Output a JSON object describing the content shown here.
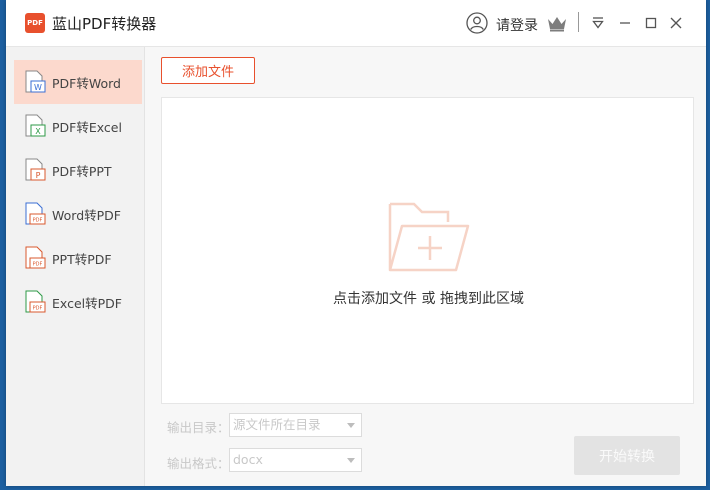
{
  "app": {
    "logo_text": "PDF",
    "title": "蓝山PDF转换器",
    "brand_color": "#e8502d"
  },
  "header": {
    "login_label": "请登录",
    "icons": [
      "user-icon",
      "crown-icon",
      "menu-icon",
      "minimize-icon",
      "maximize-icon",
      "close-icon"
    ]
  },
  "sidebar": {
    "active_index": 0,
    "items": [
      {
        "label": "PDF转Word",
        "badge": "W",
        "badge_color": "#3b6fd4"
      },
      {
        "label": "PDF转Excel",
        "badge": "X",
        "badge_color": "#2e9a47"
      },
      {
        "label": "PDF转PPT",
        "badge": "P",
        "badge_color": "#d9582e"
      },
      {
        "label": "Word转PDF",
        "badge": "PDF",
        "badge_color": "#d9582e"
      },
      {
        "label": "PPT转PDF",
        "badge": "PDF",
        "badge_color": "#d9582e"
      },
      {
        "label": "Excel转PDF",
        "badge": "PDF",
        "badge_color": "#d9582e"
      }
    ]
  },
  "main": {
    "add_file_label": "添加文件",
    "drop_hint": "点击添加文件 或 拖拽到此区域",
    "output_dir": {
      "label": "输出目录：",
      "value": "源文件所在目录"
    },
    "output_format": {
      "label": "输出格式：",
      "value": "docx"
    },
    "start_label": "开始转换"
  }
}
